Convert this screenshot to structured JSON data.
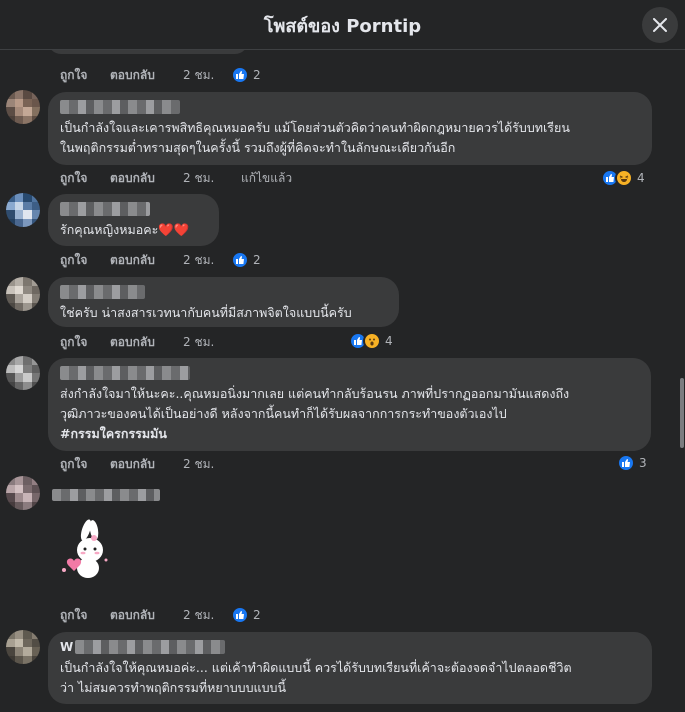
{
  "header": {
    "title": "โพสต์ของ Porntip"
  },
  "colors": {
    "background": "#242526",
    "bubble": "#3a3b3c",
    "like_blue": "#1877f2",
    "reaction_yellow": "#f7b125",
    "muted": "#b0b3b8"
  },
  "comments": [
    {
      "text_lines": [],
      "actions": {
        "like": "ถูกใจ",
        "reply": "ตอบกลับ",
        "time": "2 ชม."
      },
      "reactions": {
        "icons": [
          "like-icon"
        ],
        "count": "2"
      }
    },
    {
      "text_lines": [
        "เป็นกำลังใจและเคารพสิทธิคุณหมอครับ แม้โดยส่วนตัวคิดว่าคนทำผิดกฎหมายควรได้รับบทเรียน",
        "ในพฤติกรรมต่ำทรามสุดๆในครั้งนี้ รวมถึงผู้ที่คิดจะทำในลักษณะเดียวกันอีก"
      ],
      "actions": {
        "like": "ถูกใจ",
        "reply": "ตอบกลับ",
        "time": "2 ชม.",
        "edited": "แก้ไขแล้ว"
      },
      "reactions": {
        "icons": [
          "like-icon",
          "haha-icon"
        ],
        "count": "4"
      }
    },
    {
      "text_lines": [
        "รักคุณหญิงหมอคะ❤️❤️"
      ],
      "actions": {
        "like": "ถูกใจ",
        "reply": "ตอบกลับ",
        "time": "2 ชม."
      },
      "reactions": {
        "icons": [
          "like-icon"
        ],
        "count": "2"
      }
    },
    {
      "text_lines": [
        "ใช่ครับ น่าสงสารเวทนากับคนที่มีสภาพจิตใจแบบนี้ครับ"
      ],
      "actions": {
        "like": "ถูกใจ",
        "reply": "ตอบกลับ",
        "time": "2 ชม."
      },
      "reactions": {
        "icons": [
          "like-icon",
          "wow-icon"
        ],
        "count": "4"
      }
    },
    {
      "text_lines": [
        "ส่งกำลังใจมาให้นะคะ..คุณหมอนิ่งมากเลย แต่คนทำกลับร้อนรน ภาพที่ปรากฏออกมามันแสดงถึง",
        "วุฒิภาวะของคนได้เป็นอย่างดี หลังจากนี้คนทำก็ได้รับผลจากการกระทำของตัวเองไป",
        "#กรรมใครกรรมมัน"
      ],
      "actions": {
        "like": "ถูกใจ",
        "reply": "ตอบกลับ",
        "time": "2 ชม."
      },
      "reactions": {
        "icons": [
          "like-icon"
        ],
        "count": "3"
      }
    },
    {
      "text_lines": [],
      "sticker": "bunny-heart-sticker",
      "actions": {
        "like": "ถูกใจ",
        "reply": "ตอบกลับ",
        "time": "2 ชม."
      },
      "reactions": {
        "icons": [
          "like-icon"
        ],
        "count": "2"
      }
    },
    {
      "name_prefix": "W",
      "text_lines": [
        "เป็นกำลังใจให้คุณหมอค่ะ... แต่เค้าทำผิดแบบนี้ ควรได้รับบทเรียนที่เค้าจะต้องจดจำไปตลอดชีวิต",
        "ว่า ไม่สมควรทำพฤติกรรมที่หยาบบบแบบนี้"
      ]
    }
  ]
}
